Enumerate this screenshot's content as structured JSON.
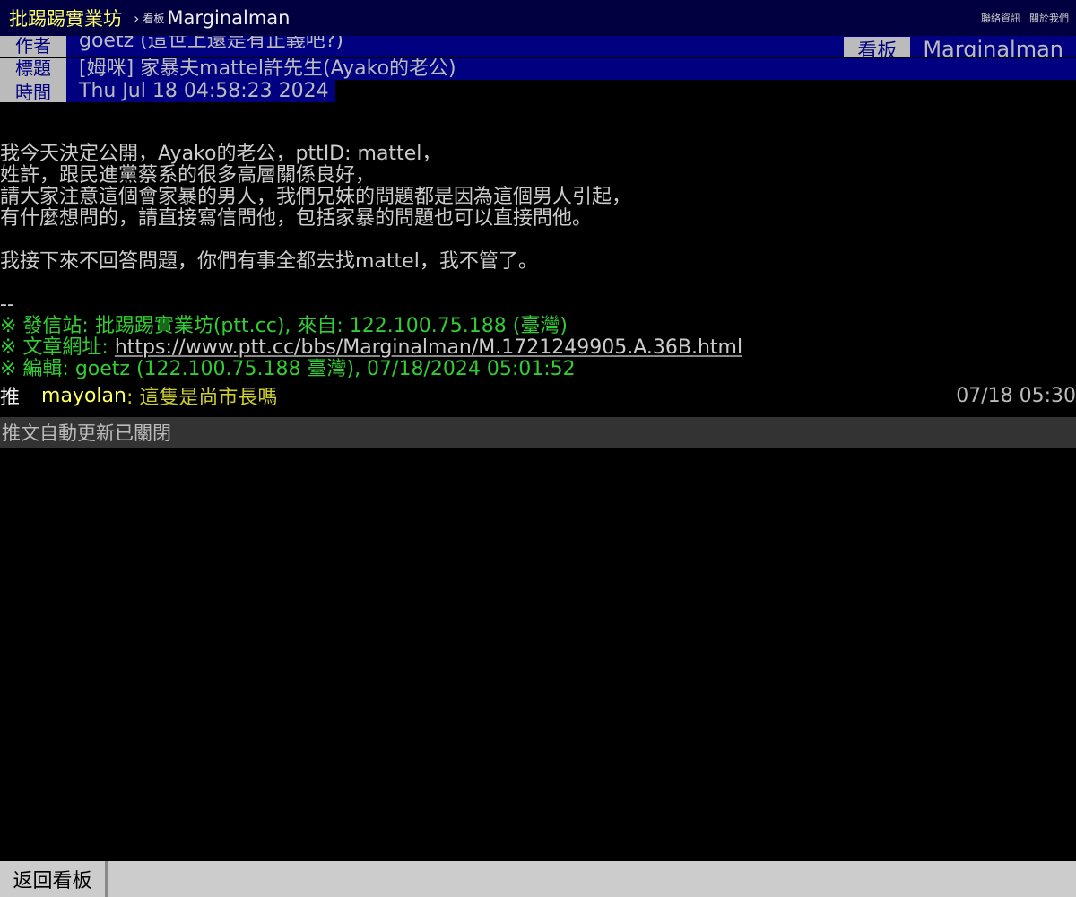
{
  "topbar": {
    "site_name": "批踢踢實業坊",
    "separator": "›",
    "board_label": "看板",
    "board_name": "Marginalman",
    "links": [
      "聯絡資訊",
      "關於我們"
    ]
  },
  "meta": {
    "author_tag": "作者",
    "author": "goetz (這世上還是有正義吧?)",
    "title_tag": "標題",
    "title": "[姆咪] 家暴夫mattel許先生(Ayako的老公)",
    "time_tag": "時間",
    "time": "Thu Jul 18 04:58:23 2024",
    "board_tag": "看板",
    "board": "Marginalman"
  },
  "content": {
    "lines": [
      "我今天決定公開，Ayako的老公，pttID: mattel，",
      "姓許，跟民進黨蔡系的很多高層關係良好，",
      "請大家注意這個會家暴的男人，我們兄妹的問題都是因為這個男人引起，",
      "有什麼想問的，請直接寫信問他，包括家暴的問題也可以直接問他。",
      "我接下來不回答問題，你們有事全都去找mattel，我不管了。",
      "--"
    ],
    "sig_post": "※ 發信站: 批踢踢實業坊(ptt.cc), 來自: 122.100.75.188 (臺灣)",
    "sig_url_prefix": "※ 文章網址: ",
    "sig_url": "https://www.ptt.cc/bbs/Marginalman/M.1721249905.A.36B.html",
    "sig_edit": "※ 編輯: goetz (122.100.75.188 臺灣), 07/18/2024 05:01:52"
  },
  "push": {
    "tag": "推",
    "user": "mayolan",
    "content": ": 這隻是尚市長嗎",
    "time": "07/18 05:30"
  },
  "autoupdate": "推文自動更新已關閉",
  "bottombar": {
    "back_label": "返回看板"
  }
}
